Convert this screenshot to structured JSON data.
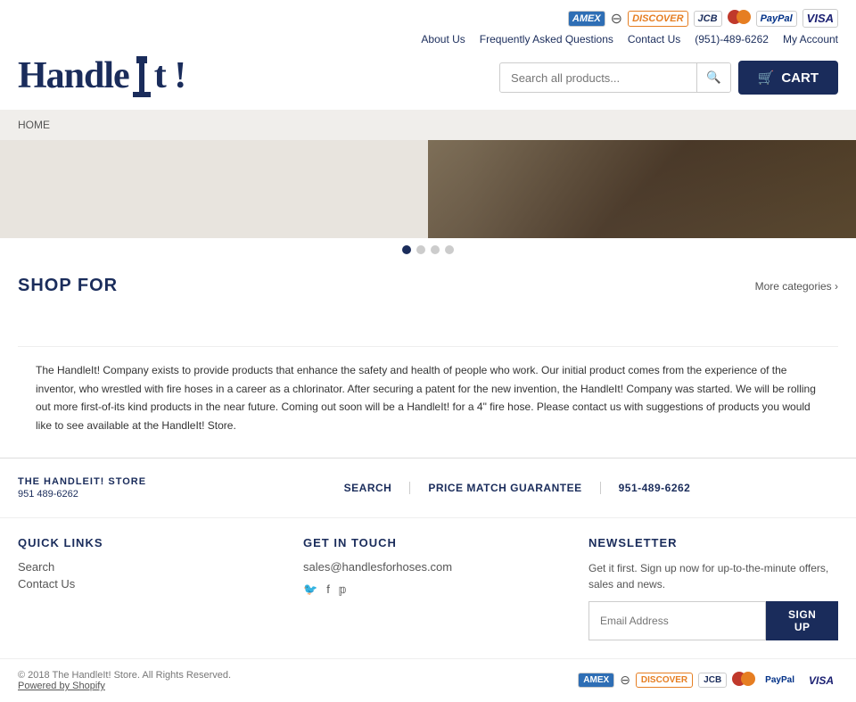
{
  "header": {
    "logo_text": "Handle",
    "logo_symbol": "I",
    "logo_exclaim": "t !",
    "nav_links": [
      "About Us",
      "Frequently Asked Questions",
      "Contact Us",
      "(951)-489-6262",
      "My Account"
    ],
    "search_placeholder": "Search all products...",
    "cart_label": "CART"
  },
  "breadcrumb": {
    "home": "HOME"
  },
  "hero": {
    "dots": [
      true,
      false,
      false,
      false
    ]
  },
  "shop": {
    "title": "SHOP FOR",
    "more_categories": "More categories ›"
  },
  "about": {
    "text": "The HandleIt! Company exists to provide products that enhance the safety and health of people who work. Our initial product comes from the experience of the inventor, who wrestled with fire hoses in a career as a chlorinator. After securing a patent for the new invention, the HandleIt! Company was started. We will be rolling out more first-of-its kind products in the near future. Coming out soon will be a HandleIt! for a 4\" fire hose. Please contact us with suggestions of products you would like to see available at the HandleIt! Store."
  },
  "footer_top": {
    "store_name": "THE HANDLEIT! STORE",
    "store_phone": "951 489-6262",
    "links": [
      "SEARCH",
      "PRICE MATCH GUARANTEE",
      "951-489-6262"
    ]
  },
  "footer": {
    "quick_links": {
      "title": "QUICK LINKS",
      "items": [
        "Search",
        "Contact Us"
      ]
    },
    "get_in_touch": {
      "title": "GET IN TOUCH",
      "email": "sales@handlesforhoses.com",
      "social": [
        "twitter",
        "facebook",
        "pinterest"
      ]
    },
    "newsletter": {
      "title": "NEWSLETTER",
      "description": "Get it first. Sign up now for up-to-the-minute offers, sales and news.",
      "placeholder": "Email Address",
      "button": "SIGN UP"
    }
  },
  "copyright": {
    "text": "© 2018 The HandleIt! Store. All Rights Reserved.",
    "powered": "Powered by Shopify"
  },
  "payment_methods": [
    "amex",
    "diners",
    "discover",
    "jcb",
    "mastercard",
    "paypal",
    "visa"
  ]
}
